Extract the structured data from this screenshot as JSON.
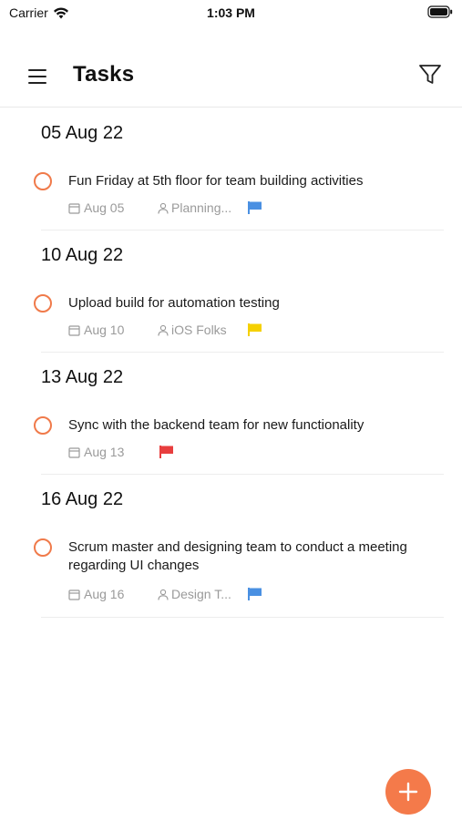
{
  "status_bar": {
    "carrier": "Carrier",
    "time": "1:03 PM",
    "wifi_icon": "wifi-icon",
    "battery_icon": "battery-icon"
  },
  "header": {
    "title": "Tasks",
    "menu_icon": "hamburger-menu-icon",
    "filter_icon": "filter-icon"
  },
  "colors": {
    "accent": "#f47a4a",
    "flag_blue": "#4a90e2",
    "flag_yellow": "#f5d000",
    "flag_red": "#e83e3e"
  },
  "groups": [
    {
      "date": "05 Aug 22",
      "tasks": [
        {
          "title": "Fun Friday at 5th floor for team building activities",
          "due": "Aug 05",
          "assignee": "Planning...",
          "flag_color": "#4a90e2"
        }
      ]
    },
    {
      "date": "10 Aug 22",
      "tasks": [
        {
          "title": "Upload build for automation testing",
          "due": "Aug 10",
          "assignee": "iOS Folks",
          "flag_color": "#f5d000"
        }
      ]
    },
    {
      "date": "13 Aug 22",
      "tasks": [
        {
          "title": "Sync with the backend team for new functionality",
          "due": "Aug 13",
          "assignee": "",
          "flag_color": "#e83e3e"
        }
      ]
    },
    {
      "date": "16 Aug 22",
      "tasks": [
        {
          "title": "Scrum master and designing team to conduct a meeting regarding UI changes",
          "due": "Aug 16",
          "assignee": "Design T...",
          "flag_color": "#4a90e2"
        }
      ]
    }
  ],
  "fab": {
    "icon": "plus-icon"
  }
}
